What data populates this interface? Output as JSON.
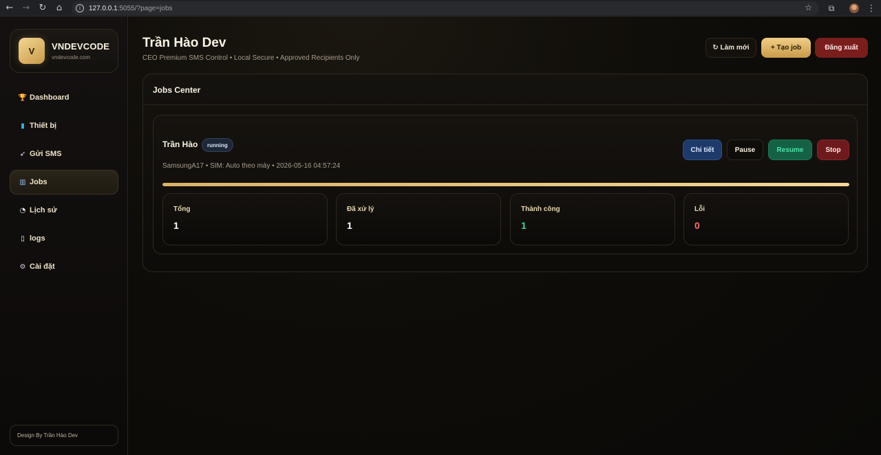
{
  "browser": {
    "url_host": "127.0.0.1",
    "url_path": ":5055/?page=jobs"
  },
  "brand": {
    "logo_letter": "V",
    "name": "VNDEVCODE",
    "domain": "vndevcode.com"
  },
  "sidebar": {
    "items": [
      {
        "icon": "trophy-icon",
        "label": "Dashboard",
        "active": false
      },
      {
        "icon": "phone-icon",
        "label": "Thiết bị",
        "active": false
      },
      {
        "icon": "rocket-icon",
        "label": "Gửi SMS",
        "active": false
      },
      {
        "icon": "chart-icon",
        "label": "Jobs",
        "active": true
      },
      {
        "icon": "clock-icon",
        "label": "Lịch sử",
        "active": false
      },
      {
        "icon": "document-icon",
        "label": "logs",
        "active": false
      },
      {
        "icon": "gear-icon",
        "label": "Cài đặt",
        "active": false
      }
    ],
    "footer": "Design By Trần Hào Dev"
  },
  "header": {
    "title": "Trần Hào Dev",
    "subtitle": "CEO Premium SMS Control • Local Secure • Approved Recipients Only",
    "refresh_label": "↻ Làm mới",
    "create_label": "+ Tạo job",
    "logout_label": "Đăng xuất"
  },
  "jobs_panel": {
    "title": "Jobs Center",
    "job": {
      "name": "Trần Hào",
      "status": "running",
      "meta": "SamsungA17 • SIM: Auto theo máy • 2026-05-16 04:57:24",
      "progress": 1.0,
      "actions": {
        "detail": "Chi tiết",
        "pause": "Pause",
        "resume": "Resume",
        "stop": "Stop"
      },
      "stats": [
        {
          "label": "Tổng",
          "value": "1",
          "tone": "default"
        },
        {
          "label": "Đã xử lý",
          "value": "1",
          "tone": "default"
        },
        {
          "label": "Thành công",
          "value": "1",
          "tone": "green"
        },
        {
          "label": "Lỗi",
          "value": "0",
          "tone": "red"
        }
      ]
    }
  },
  "colors": {
    "accent_gold": "#e2b96e",
    "success": "#34d399",
    "danger": "#f87171",
    "logout_bg": "#7a1d1d"
  }
}
